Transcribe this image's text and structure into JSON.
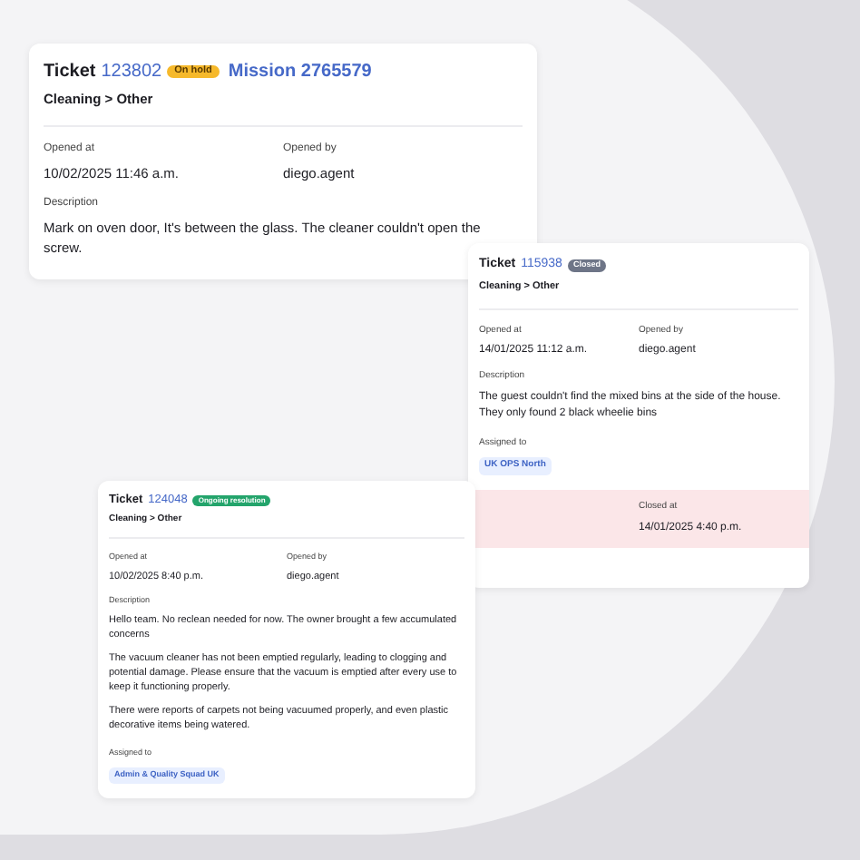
{
  "tickets": [
    {
      "label": "Ticket",
      "number": "123802",
      "status": {
        "text": "On hold",
        "kind": "on_hold"
      },
      "mission": "Mission 2765579",
      "category": "Cleaning > Other",
      "fields": [
        {
          "label": "Opened at",
          "value": "10/02/2025 11:46 a.m."
        },
        {
          "label": "Opened by",
          "value": "diego.agent"
        }
      ],
      "description": {
        "label": "Description",
        "paragraphs": [
          "Mark on oven door, It's between the glass. The cleaner couldn't open the screw."
        ]
      }
    },
    {
      "label": "Ticket",
      "number": "115938",
      "status": {
        "text": "Closed",
        "kind": "closed"
      },
      "category": "Cleaning > Other",
      "fields": [
        {
          "label": "Opened at",
          "value": "14/01/2025 11:12 a.m."
        },
        {
          "label": "Opened by",
          "value": "diego.agent"
        }
      ],
      "description": {
        "label": "Description",
        "paragraphs": [
          "The guest couldn't find the mixed bins at the side of the house. They only found 2 black wheelie bins"
        ]
      },
      "assigned": {
        "label": "Assigned to",
        "team": "UK OPS North"
      },
      "closed": {
        "label": "Closed at",
        "value": "14/01/2025 4:40 p.m."
      }
    },
    {
      "label": "Ticket",
      "number": "124048",
      "status": {
        "text": "Ongoing resolution",
        "kind": "ongoing"
      },
      "category": "Cleaning > Other",
      "fields": [
        {
          "label": "Opened at",
          "value": "10/02/2025 8:40 p.m."
        },
        {
          "label": "Opened by",
          "value": "diego.agent"
        }
      ],
      "description": {
        "label": "Description",
        "paragraphs": [
          "Hello team. No reclean needed for now. The owner brought a few accumulated concerns",
          "The vacuum cleaner has not been emptied regularly, leading to clogging and potential damage. Please ensure that the vacuum is emptied after every use to keep it functioning properly.",
          "There were reports of carpets not being vacuumed properly, and even plastic decorative items being watered."
        ]
      },
      "assigned": {
        "label": "Assigned to",
        "team": "Admin & Quality Squad UK"
      }
    }
  ]
}
